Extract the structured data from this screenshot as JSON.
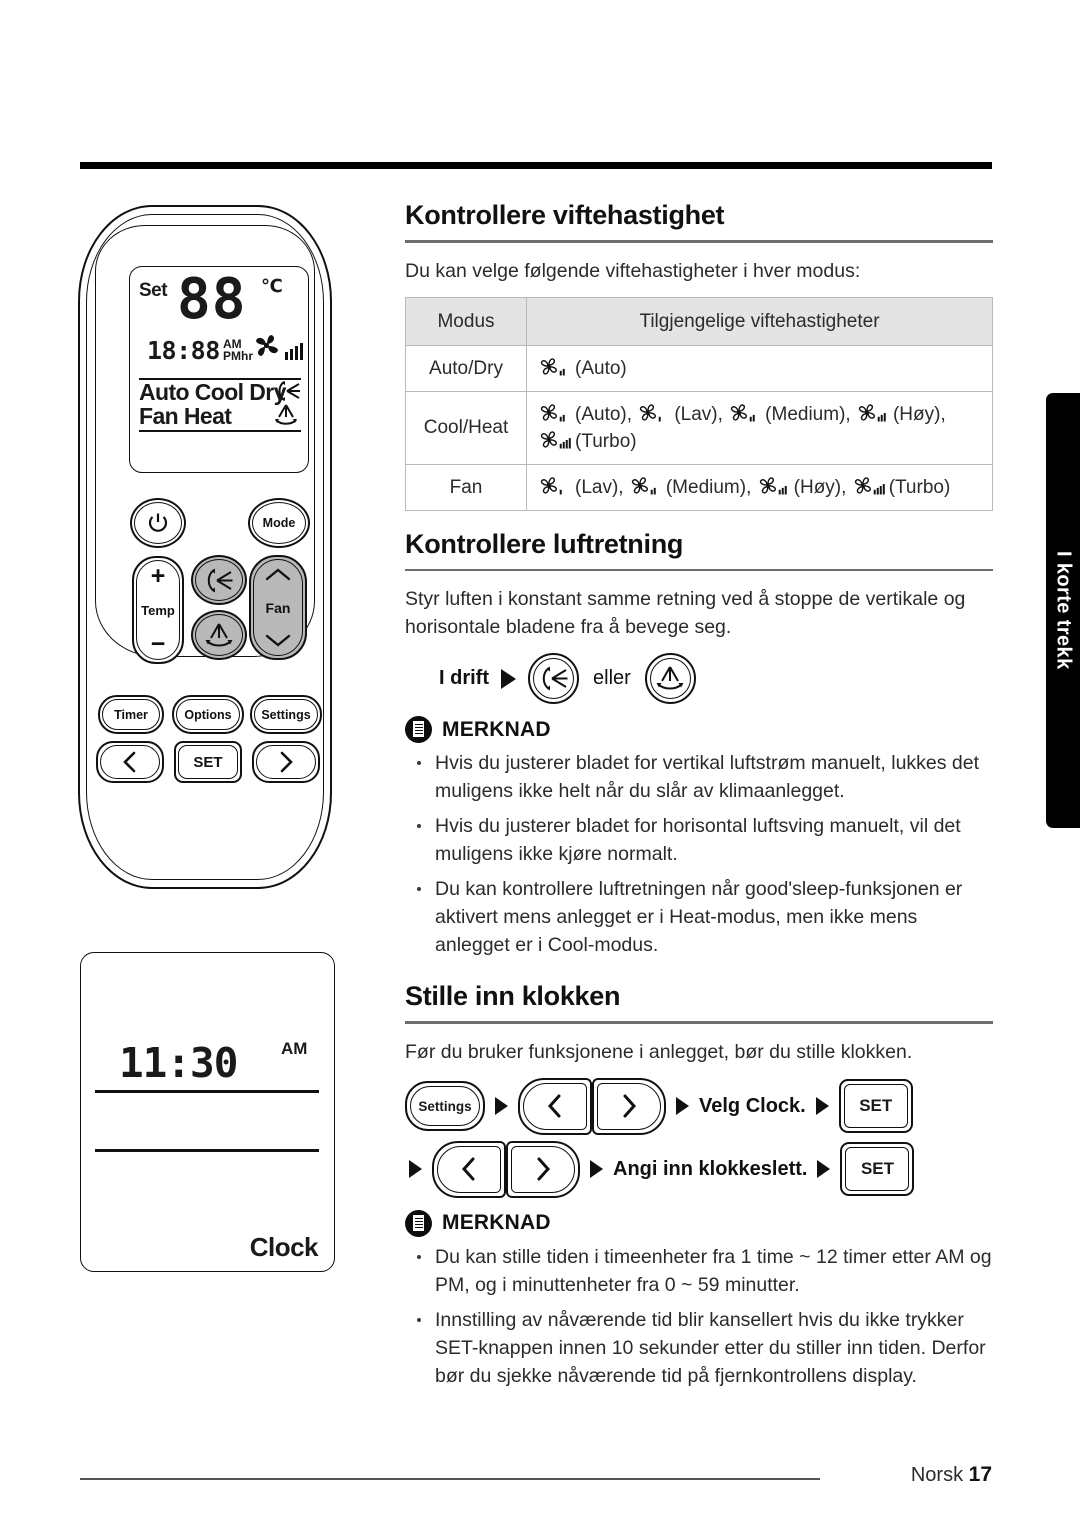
{
  "page": {
    "footer_label": "Norsk",
    "footer_page": "17",
    "side_tab": "I korte trekk"
  },
  "remote": {
    "display": {
      "set_label": "Set",
      "temp_digits": "88",
      "unit": "℃",
      "time_digits": "18:88",
      "am": "AM",
      "pm_hr": "PMhr",
      "modes_line1": "Auto Cool Dry",
      "modes_line2": "Fan  Heat",
      "fan_icon": "fan-icon",
      "fan_bars": 4,
      "vertical_swing_icon": "vertical-swing-icon",
      "horizontal_swing_icon": "horizontal-swing-icon"
    },
    "buttons": {
      "power": "power-icon",
      "mode": "Mode",
      "temp": "Temp",
      "temp_plus": "+",
      "temp_minus": "−",
      "swing_vertical": "vertical-swing-icon",
      "swing_horizontal": "horizontal-swing-icon",
      "fan": "Fan",
      "timer": "Timer",
      "options": "Options",
      "settings": "Settings",
      "left": "‹",
      "set": "SET",
      "right": "›"
    }
  },
  "clock_figure": {
    "time": "11:30",
    "ampm": "AM",
    "label": "Clock"
  },
  "sections": {
    "fan_speed": {
      "heading": "Kontrollere viftehastighet",
      "intro": "Du kan velge følgende viftehastigheter i hver modus:",
      "table": {
        "headers": [
          "Modus",
          "Tilgjengelige viftehastigheter"
        ],
        "rows": [
          {
            "mode": "Auto/Dry",
            "speeds": [
              {
                "icon": "fan-auto-icon",
                "bars": 2,
                "label": "(Auto)"
              }
            ]
          },
          {
            "mode": "Cool/Heat",
            "speeds": [
              {
                "icon": "fan-auto-icon",
                "bars": 2,
                "label": "(Auto),"
              },
              {
                "icon": "fan-low-icon",
                "bars": 1,
                "label": "(Lav),"
              },
              {
                "icon": "fan-medium-icon",
                "bars": 2,
                "label": "(Medium),"
              },
              {
                "icon": "fan-high-icon",
                "bars": 3,
                "label": "(Høy),"
              },
              {
                "icon": "fan-turbo-icon",
                "bars": 4,
                "label": "(Turbo)"
              }
            ]
          },
          {
            "mode": "Fan",
            "speeds": [
              {
                "icon": "fan-low-icon",
                "bars": 1,
                "label": "(Lav),"
              },
              {
                "icon": "fan-medium-icon",
                "bars": 2,
                "label": "(Medium),"
              },
              {
                "icon": "fan-high-icon",
                "bars": 3,
                "label": "(Høy),"
              },
              {
                "icon": "fan-turbo-icon",
                "bars": 4,
                "label": "(Turbo)"
              }
            ]
          }
        ]
      }
    },
    "air_direction": {
      "heading": "Kontrollere luftretning",
      "intro": "Styr luften i konstant samme retning ved å stoppe de vertikale og horisontale bladene fra å bevege seg.",
      "step_label": "I drift",
      "or_label": "eller",
      "note_title": "MERKNAD",
      "notes": [
        "Hvis du justerer bladet for vertikal luftstrøm manuelt, lukkes det muligens ikke helt når du slår av klimaanlegget.",
        "Hvis du justerer bladet for horisontal luftsving manuelt, vil det muligens ikke kjøre normalt.",
        "Du kan kontrollere luftretningen når good'sleep-funksjonen er aktivert mens anlegget er i Heat-modus, men ikke mens anlegget er i Cool-modus."
      ]
    },
    "set_clock": {
      "heading": "Stille inn klokken",
      "intro": "Før du bruker funksjonene i anlegget, bør du stille klokken.",
      "row1": {
        "settings_label": "Settings",
        "left_label": "‹",
        "right_label": "›",
        "text": "Velg Clock.",
        "set_label": "SET"
      },
      "row2": {
        "left_label": "‹",
        "right_label": "›",
        "text": "Angi inn klokkeslett.",
        "set_label": "SET"
      },
      "note_title": "MERKNAD",
      "notes": [
        "Du kan stille tiden i timeenheter fra 1 time ~ 12 timer etter AM og PM, og i minuttenheter fra 0 ~ 59 minutter.",
        "Innstilling av nåværende tid blir kansellert hvis du ikke trykker SET-knappen innen 10 sekunder etter du stiller inn tiden. Derfor bør du sjekke nåværende tid på fjernkontrollens display."
      ]
    }
  }
}
